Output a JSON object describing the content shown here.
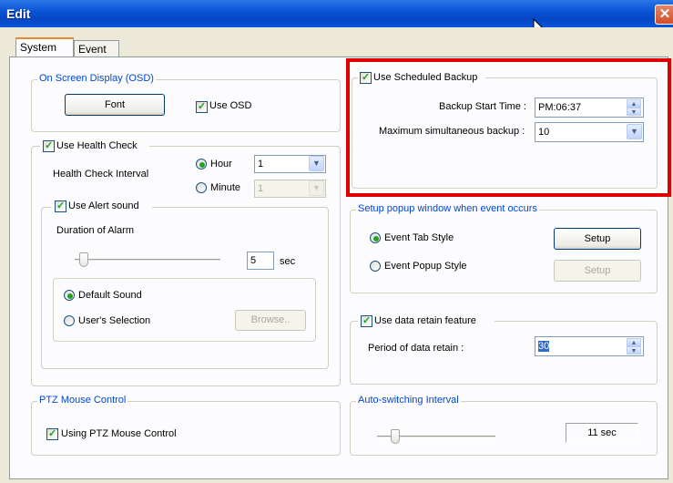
{
  "window": {
    "title": "Edit",
    "close_glyph": "✕"
  },
  "tabs": [
    {
      "label": "System",
      "active": true
    },
    {
      "label": "Event",
      "active": false
    }
  ],
  "osd": {
    "legend": "On Screen Display (OSD)",
    "font_button": "Font",
    "use_osd_label": "Use OSD",
    "use_osd": true
  },
  "health": {
    "label": "Use Health Check",
    "enabled": true,
    "interval_label": "Health Check Interval",
    "hour_label": "Hour",
    "minute_label": "Minute",
    "selected_unit": "Hour",
    "hour_value": "1",
    "minute_value": "1",
    "alert": {
      "label": "Use Alert sound",
      "enabled": true,
      "duration_label": "Duration of Alarm",
      "duration_value": "5",
      "duration_unit": "sec",
      "default_sound_label": "Default Sound",
      "user_selection_label": "User's Selection",
      "selected_sound": "Default Sound",
      "browse_button": "Browse.."
    }
  },
  "ptz": {
    "legend": "PTZ Mouse Control",
    "label": "Using PTZ Mouse Control",
    "enabled": true
  },
  "backup": {
    "label": "Use Scheduled Backup",
    "enabled": true,
    "start_time_label": "Backup Start Time :",
    "start_time_value": "PM:06:37",
    "max_label": "Maximum simultaneous backup :",
    "max_value": "10"
  },
  "popup": {
    "legend": "Setup popup window when event occurs",
    "tab_style_label": "Event Tab Style",
    "popup_style_label": "Event Popup Style",
    "selected_style": "Event Tab Style",
    "setup_button": "Setup",
    "setup_button_disabled": "Setup"
  },
  "retain": {
    "label": "Use data retain feature",
    "enabled": true,
    "period_label": "Period of data retain :",
    "period_value": "30"
  },
  "autoswitch": {
    "legend": "Auto-switching Interval",
    "value": "11 sec"
  },
  "icons": {
    "spin_up": "▲",
    "spin_down": "▼",
    "dropdown": "▼",
    "check": "✓"
  },
  "colors": {
    "title_bar": "#0a54d6",
    "legend_text": "#0046d5",
    "highlight": "#e00000",
    "panel_bg": "#fcfcfe",
    "window_bg": "#ece9d8"
  }
}
